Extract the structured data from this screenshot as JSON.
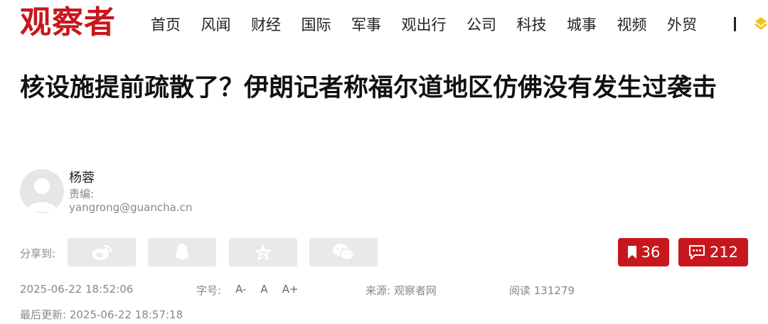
{
  "header": {
    "logo": "观察者",
    "nav": [
      "首页",
      "风闻",
      "财经",
      "国际",
      "军事",
      "观出行",
      "公司",
      "科技",
      "城事",
      "视频",
      "外贸"
    ],
    "separator": "|"
  },
  "article": {
    "title": "核设施提前疏散了？伊朗记者称福尔道地区仿佛没有发生过袭击",
    "author": "杨蓉",
    "editor_label": "责编:",
    "email": "yangrong@guancha.cn"
  },
  "share": {
    "label": "分享到:",
    "icons": [
      "weibo-icon",
      "qq-icon",
      "qzone-icon",
      "wechat-icon"
    ]
  },
  "actions": {
    "bookmark_count": "36",
    "comment_count": "212"
  },
  "meta": {
    "publish_time": "2025-06-22 18:52:06",
    "font_size_label": "字号:",
    "font_sizes": [
      "A-",
      "A",
      "A+"
    ],
    "source": "来源: 观察者网",
    "reads": "阅读 131279",
    "updated": "最后更新: 2025-06-22 18:57:18"
  },
  "colors": {
    "brand": "#c8161d",
    "muted": "#888888",
    "button_gray": "#e9e9e9"
  }
}
